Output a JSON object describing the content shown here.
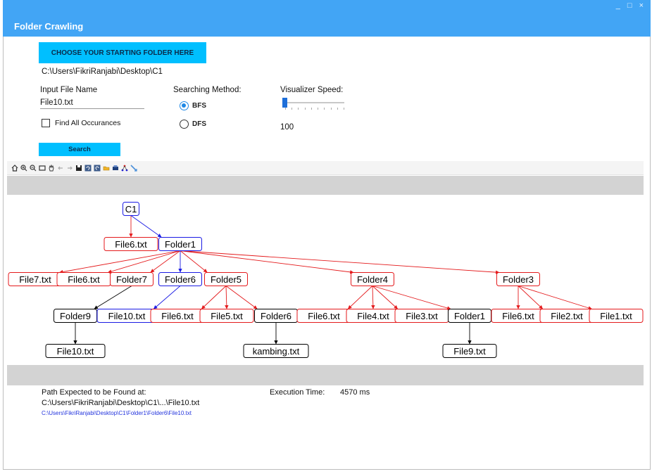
{
  "window": {
    "title": "Folder Crawling",
    "controls": [
      "_",
      "□",
      "×"
    ]
  },
  "form": {
    "choose_button": "CHOOSE YOUR STARTING FOLDER HERE",
    "start_path": "C:\\Users\\FikriRanjabi\\Desktop\\C1",
    "file_name_label": "Input File Name",
    "file_name_value": "File10.txt",
    "find_all_label": "Find All Occurances",
    "find_all_checked": false,
    "method_label": "Searching Method:",
    "methods": [
      {
        "label": "BFS",
        "selected": true
      },
      {
        "label": "DFS",
        "selected": false
      }
    ],
    "speed_label": "Visualizer Speed:",
    "speed_value": "100",
    "search_button": "Search"
  },
  "toolbar": {
    "icons": [
      "home-icon",
      "zoom-in-icon",
      "zoom-out-icon",
      "zoom-rect-icon",
      "pan-hand-icon",
      "back-arrow-icon",
      "forward-arrow-icon",
      "save-icon",
      "undo-icon",
      "redo-icon",
      "open-folder-icon",
      "print-icon",
      "layout-graph-icon",
      "edge-tool-icon"
    ]
  },
  "graph": {
    "colors": {
      "red": "#e41a1c",
      "blue": "#1a1ae4",
      "black": "#000000"
    },
    "nodes": [
      {
        "id": "c1",
        "label": "C1",
        "color": "blue"
      },
      {
        "id": "f6a",
        "label": "File6.txt",
        "color": "red"
      },
      {
        "id": "folder1",
        "label": "Folder1",
        "color": "blue"
      },
      {
        "id": "f7",
        "label": "File7.txt",
        "color": "red"
      },
      {
        "id": "f6b",
        "label": "File6.txt",
        "color": "red"
      },
      {
        "id": "folder7",
        "label": "Folder7",
        "color": "red"
      },
      {
        "id": "folder6a",
        "label": "Folder6",
        "color": "blue"
      },
      {
        "id": "folder5",
        "label": "Folder5",
        "color": "red"
      },
      {
        "id": "folder4",
        "label": "Folder4",
        "color": "red"
      },
      {
        "id": "folder3",
        "label": "Folder3",
        "color": "red"
      },
      {
        "id": "folder9",
        "label": "Folder9",
        "color": "black"
      },
      {
        "id": "f10a",
        "label": "File10.txt",
        "color": "blue"
      },
      {
        "id": "f6c",
        "label": "File6.txt",
        "color": "red"
      },
      {
        "id": "f5",
        "label": "File5.txt",
        "color": "red"
      },
      {
        "id": "folder6b",
        "label": "Folder6",
        "color": "black"
      },
      {
        "id": "f6d",
        "label": "File6.txt",
        "color": "red"
      },
      {
        "id": "f4",
        "label": "File4.txt",
        "color": "red"
      },
      {
        "id": "f3",
        "label": "File3.txt",
        "color": "red"
      },
      {
        "id": "folder1b",
        "label": "Folder1",
        "color": "black"
      },
      {
        "id": "f6e",
        "label": "File6.txt",
        "color": "red"
      },
      {
        "id": "f2",
        "label": "File2.txt",
        "color": "red"
      },
      {
        "id": "f1",
        "label": "File1.txt",
        "color": "red"
      },
      {
        "id": "f10b",
        "label": "File10.txt",
        "color": "black"
      },
      {
        "id": "kambing",
        "label": "kambing.txt",
        "color": "black"
      },
      {
        "id": "f9",
        "label": "File9.txt",
        "color": "black"
      }
    ],
    "edges": [
      {
        "from": "c1",
        "to": "f6a",
        "color": "red"
      },
      {
        "from": "c1",
        "to": "folder1",
        "color": "blue"
      },
      {
        "from": "folder1",
        "to": "f7",
        "color": "red"
      },
      {
        "from": "folder1",
        "to": "f6b",
        "color": "red"
      },
      {
        "from": "folder1",
        "to": "folder7",
        "color": "red"
      },
      {
        "from": "folder1",
        "to": "folder6a",
        "color": "blue"
      },
      {
        "from": "folder1",
        "to": "folder5",
        "color": "red"
      },
      {
        "from": "folder1",
        "to": "folder4",
        "color": "red"
      },
      {
        "from": "folder1",
        "to": "folder3",
        "color": "red"
      },
      {
        "from": "folder7",
        "to": "folder9",
        "color": "black"
      },
      {
        "from": "folder6a",
        "to": "f10a",
        "color": "blue"
      },
      {
        "from": "folder5",
        "to": "f6c",
        "color": "red"
      },
      {
        "from": "folder5",
        "to": "f5",
        "color": "red"
      },
      {
        "from": "folder5",
        "to": "folder6b",
        "color": "red"
      },
      {
        "from": "folder4",
        "to": "f6d",
        "color": "red"
      },
      {
        "from": "folder4",
        "to": "f4",
        "color": "red"
      },
      {
        "from": "folder4",
        "to": "f3",
        "color": "red"
      },
      {
        "from": "folder4",
        "to": "folder1b",
        "color": "red"
      },
      {
        "from": "folder3",
        "to": "f6e",
        "color": "red"
      },
      {
        "from": "folder3",
        "to": "f2",
        "color": "red"
      },
      {
        "from": "folder3",
        "to": "f1",
        "color": "red"
      },
      {
        "from": "folder9",
        "to": "f10b",
        "color": "black"
      },
      {
        "from": "folder6b",
        "to": "kambing",
        "color": "black"
      },
      {
        "from": "folder1b",
        "to": "f9",
        "color": "black"
      }
    ]
  },
  "result": {
    "path_label": "Path Expected to be Found at:",
    "path_short": "C:\\Users\\FikriRanjabi\\Desktop\\C1\\...\\File10.txt",
    "path_full": "C:\\Users\\FikriRanjabi\\Desktop\\C1\\Folder1\\Folder6\\File10.txt",
    "exec_label": "Execution Time:",
    "exec_value": "4570 ms"
  }
}
